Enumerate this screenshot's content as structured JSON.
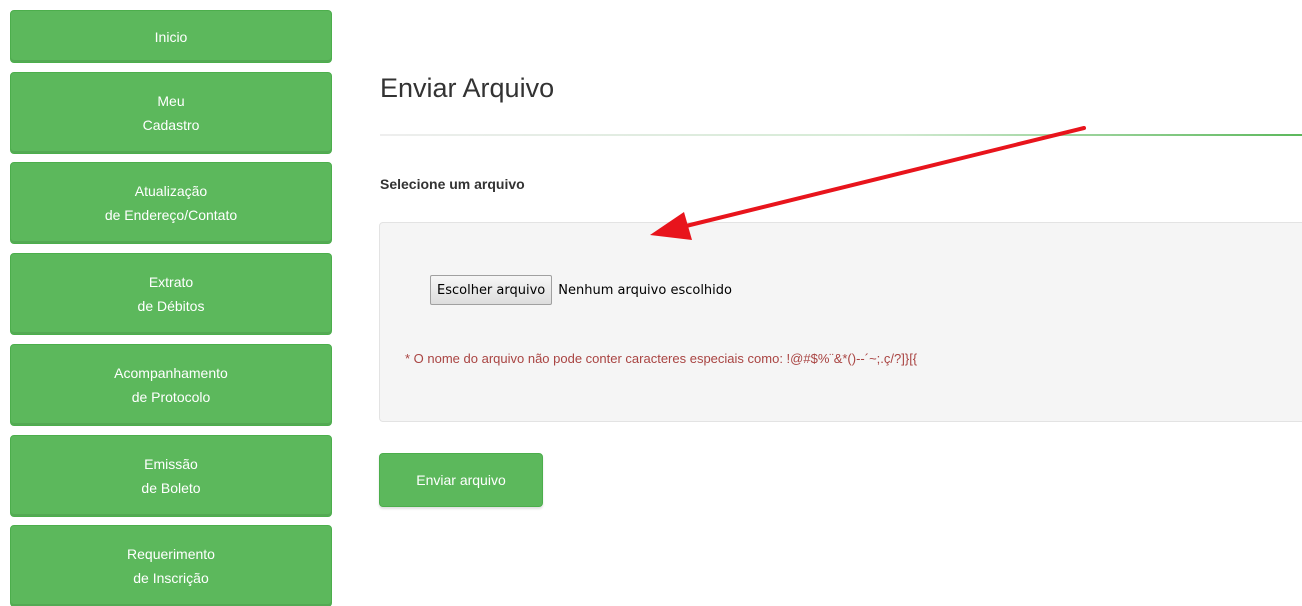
{
  "sidebar": {
    "items": [
      {
        "line1": "Inicio",
        "line2": ""
      },
      {
        "line1": "Meu",
        "line2": "Cadastro"
      },
      {
        "line1": "Atualização",
        "line2": "de Endereço/Contato"
      },
      {
        "line1": "Extrato",
        "line2": "de Débitos"
      },
      {
        "line1": "Acompanhamento",
        "line2": "de Protocolo"
      },
      {
        "line1": "Emissão",
        "line2": "de Boleto"
      },
      {
        "line1": "Requerimento",
        "line2": "de Inscrição"
      }
    ]
  },
  "main": {
    "title": "Enviar Arquivo",
    "section_label": "Selecione um arquivo",
    "file_input": {
      "button_label": "Escolher arquivo",
      "status": "Nenhum arquivo escolhido"
    },
    "warning": "* O nome do arquivo não pode conter caracteres especiais como: !@#$%¨&*()--´~;.ç/?]}[{",
    "submit_label": "Enviar arquivo"
  },
  "annotation": {
    "arrow_color": "#e8141c",
    "icon": "red-arrow-icon"
  },
  "colors": {
    "accent": "#5cb85c",
    "warning": "#a94442",
    "well_background": "#f5f5f5"
  }
}
